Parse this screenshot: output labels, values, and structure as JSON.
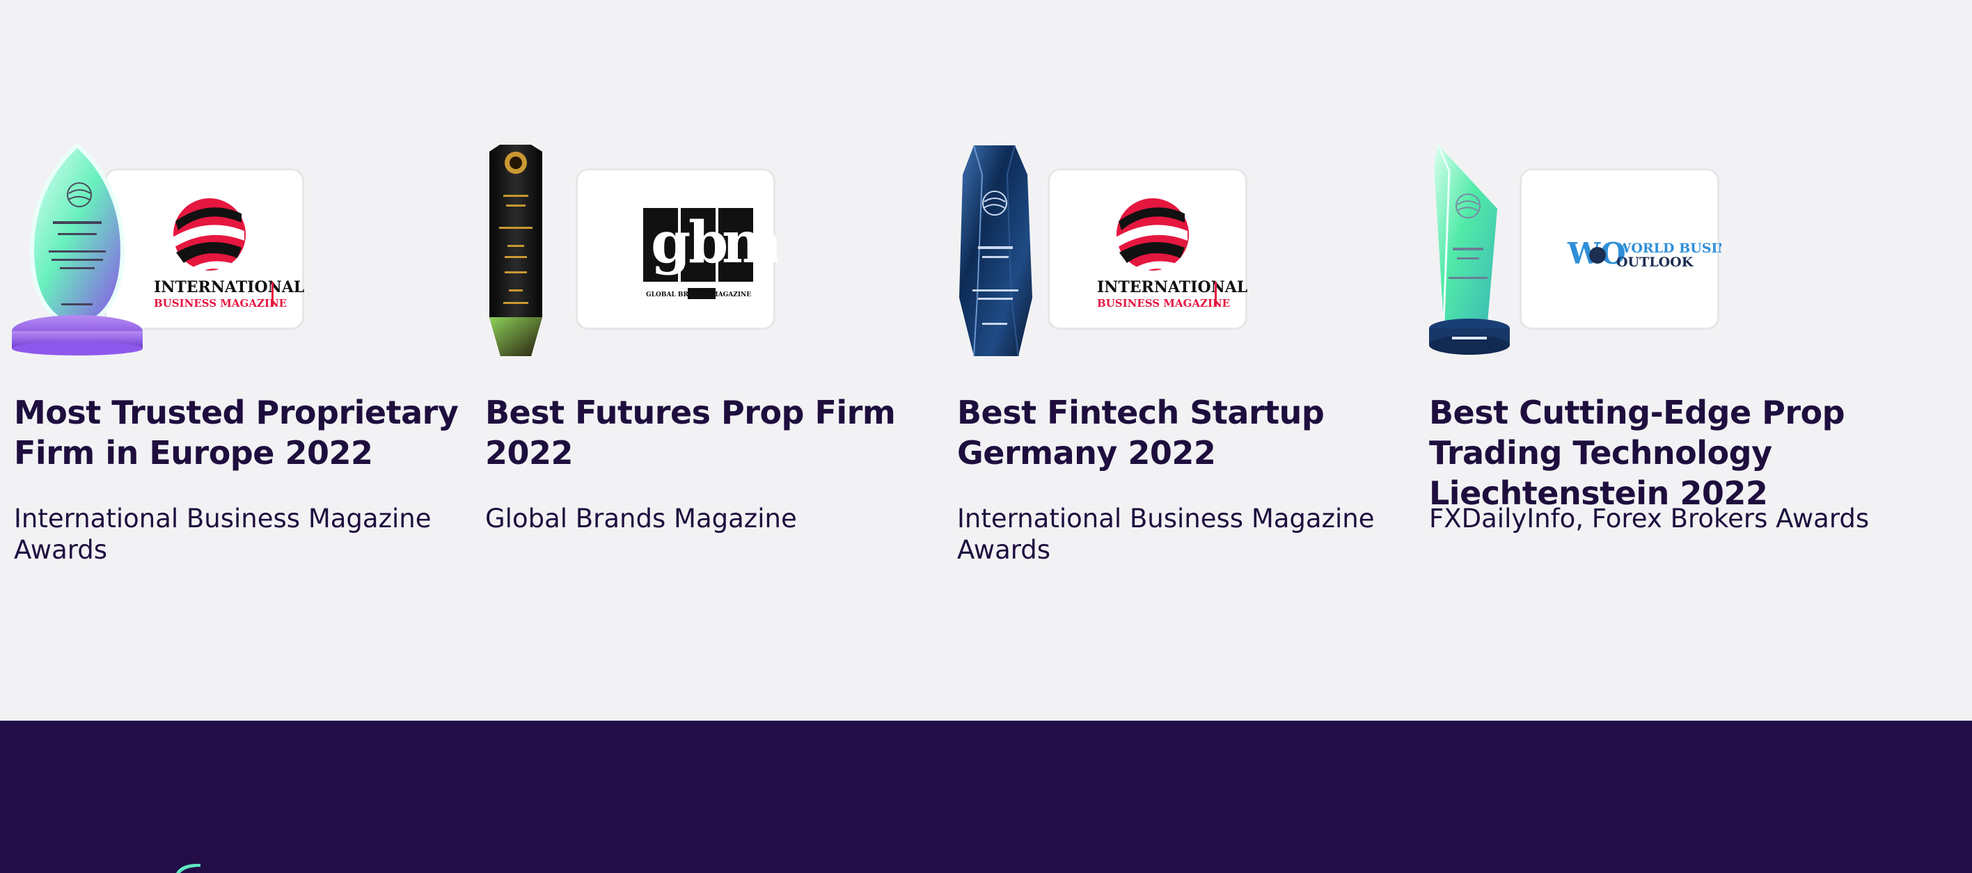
{
  "awards": [
    {
      "title": "Most Trusted Proprietary Firm in Europe 2022",
      "issuer": "International Business Magazine Awards",
      "logo": {
        "type": "international-business-magazine",
        "line1": "INTERNATIONAL",
        "line2": "BUSINESS MAGAZINE",
        "colors": {
          "red": "#e5173f",
          "black": "#111111"
        }
      },
      "trophy": {
        "type": "oval-glass",
        "colors": {
          "glass": "#69f0be",
          "base": "#7b4de6"
        }
      }
    },
    {
      "title": "Best Futures Prop Firm 2022",
      "issuer": "Global Brands Magazine",
      "logo": {
        "type": "gbm",
        "letters": [
          "g",
          "b",
          "m"
        ],
        "caption": "GLOBAL BRANDS MAGAZINE",
        "colors": {
          "black": "#111111",
          "white": "#ffffff"
        }
      },
      "trophy": {
        "type": "dark-column",
        "colors": {
          "body": "#121212",
          "accent": "#c99833"
        }
      }
    },
    {
      "title": "Best Fintech Startup Germany 2022",
      "issuer": "International Business Magazine Awards",
      "logo": {
        "type": "international-business-magazine",
        "line1": "INTERNATIONAL",
        "line2": "BUSINESS MAGAZINE",
        "colors": {
          "red": "#e5173f",
          "black": "#111111"
        }
      },
      "trophy": {
        "type": "navy-crystal",
        "colors": {
          "body": "#14345f",
          "edge": "#3e6ea8"
        }
      }
    },
    {
      "title": "Best Cutting-Edge Prop Trading Technology Liechtenstein 2022",
      "issuer": "FXDailyInfo, Forex Brokers Awards",
      "logo": {
        "type": "world-business-outlook",
        "mark": "WO",
        "line1": "WORLD BUSINESS",
        "line2": "OUTLOOK",
        "colors": {
          "blue": "#2f8fd8",
          "navy": "#1c2e52"
        }
      },
      "trophy": {
        "type": "green-crystal",
        "colors": {
          "glass": "#52eba8",
          "base": "#193e76"
        }
      }
    }
  ],
  "footer": {
    "background": "#220d47",
    "accent": "#5ee8c0"
  }
}
